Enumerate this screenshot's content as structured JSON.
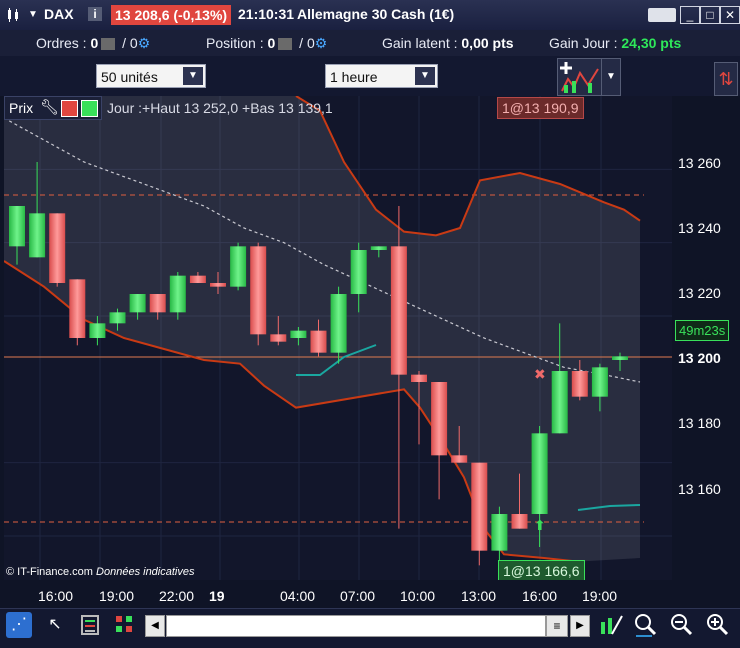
{
  "titlebar": {
    "instrument": "DAX",
    "price_change": "13 208,6 (-0,13%)",
    "time": "21:10:31",
    "name": "Allemagne 30 Cash (1€)"
  },
  "status": {
    "orders_label": "Ordres :",
    "orders_val1": "0",
    "orders_val2": "/ 0",
    "position_label": "Position :",
    "position_val1": "0",
    "position_val2": "/ 0",
    "unrealized_label": "Gain latent :",
    "unrealized_val": "0,00 pts",
    "daygain_label": "Gain Jour :",
    "daygain_val": "24,30 pts"
  },
  "options": {
    "units": "50 unités",
    "timeframe": "1 heure"
  },
  "chart": {
    "price_label": "Prix",
    "day_info": "Jour :+Haut 13 252,0 +Bas 13 139,1",
    "high_marker": "1@13 190,9",
    "low_marker": "1@13 166,6",
    "countdown": "49m23s",
    "current_price": "13 200",
    "copyright": "© IT-Finance.com",
    "indicative": "Données indicatives",
    "y_ticks": [
      "13 260",
      "13 240",
      "13 220",
      "13 180",
      "13 160"
    ],
    "x_ticks": [
      "16:00",
      "19:00",
      "22:00",
      "19",
      "04:00",
      "07:00",
      "10:00",
      "13:00",
      "16:00",
      "19:00"
    ]
  },
  "colors": {
    "up": "#39e05a",
    "down": "#f06a6a",
    "band": "#c93a14",
    "accent": "#e0463f"
  },
  "chart_data": {
    "type": "candlestick",
    "ylim": [
      13148,
      13280
    ],
    "candles": [
      {
        "o": 13239,
        "h": 13249,
        "l": 13234,
        "c": 13250
      },
      {
        "o": 13236,
        "h": 13262,
        "l": 13236,
        "c": 13248
      },
      {
        "o": 13248,
        "h": 13248,
        "l": 13228,
        "c": 13229
      },
      {
        "o": 13230,
        "h": 13230,
        "l": 13212,
        "c": 13214
      },
      {
        "o": 13214,
        "h": 13220,
        "l": 13212,
        "c": 13218
      },
      {
        "o": 13218,
        "h": 13222,
        "l": 13216,
        "c": 13221
      },
      {
        "o": 13221,
        "h": 13226,
        "l": 13219,
        "c": 13226
      },
      {
        "o": 13226,
        "h": 13226,
        "l": 13219,
        "c": 13221
      },
      {
        "o": 13221,
        "h": 13232,
        "l": 13219,
        "c": 13231
      },
      {
        "o": 13231,
        "h": 13232,
        "l": 13229,
        "c": 13229
      },
      {
        "o": 13229,
        "h": 13232,
        "l": 13226,
        "c": 13228
      },
      {
        "o": 13228,
        "h": 13240,
        "l": 13227,
        "c": 13239
      },
      {
        "o": 13239,
        "h": 13240,
        "l": 13212,
        "c": 13215
      },
      {
        "o": 13215,
        "h": 13220,
        "l": 13212,
        "c": 13213
      },
      {
        "o": 13214,
        "h": 13217,
        "l": 13212,
        "c": 13216
      },
      {
        "o": 13216,
        "h": 13219,
        "l": 13209,
        "c": 13210
      },
      {
        "o": 13210,
        "h": 13228,
        "l": 13207,
        "c": 13226
      },
      {
        "o": 13226,
        "h": 13240,
        "l": 13221,
        "c": 13238
      },
      {
        "o": 13238,
        "h": 13239,
        "l": 13236,
        "c": 13239
      },
      {
        "o": 13239,
        "h": 13250,
        "l": 13162,
        "c": 13204
      },
      {
        "o": 13204,
        "h": 13205,
        "l": 13185,
        "c": 13202
      },
      {
        "o": 13202,
        "h": 13202,
        "l": 13170,
        "c": 13182
      },
      {
        "o": 13182,
        "h": 13190,
        "l": 13180,
        "c": 13180
      },
      {
        "o": 13180,
        "h": 13180,
        "l": 13152,
        "c": 13156
      },
      {
        "o": 13156,
        "h": 13168,
        "l": 13150,
        "c": 13166
      },
      {
        "o": 13166,
        "h": 13177,
        "l": 13162,
        "c": 13162
      },
      {
        "o": 13166,
        "h": 13190,
        "l": 13157,
        "c": 13188
      },
      {
        "o": 13188,
        "h": 13218,
        "l": 13188,
        "c": 13205
      },
      {
        "o": 13205,
        "h": 13208,
        "l": 13197,
        "c": 13198
      },
      {
        "o": 13198,
        "h": 13207,
        "l": 13194,
        "c": 13206
      },
      {
        "o": 13208,
        "h": 13210,
        "l": 13205,
        "c": 13209
      }
    ]
  },
  "toolbar": {
    "tools": [
      "share-icon",
      "cursor-icon",
      "compare-icon",
      "indicator-icon",
      "drawing-icon",
      "zoom-fit-icon",
      "zoom-out-icon",
      "zoom-in-icon"
    ]
  }
}
